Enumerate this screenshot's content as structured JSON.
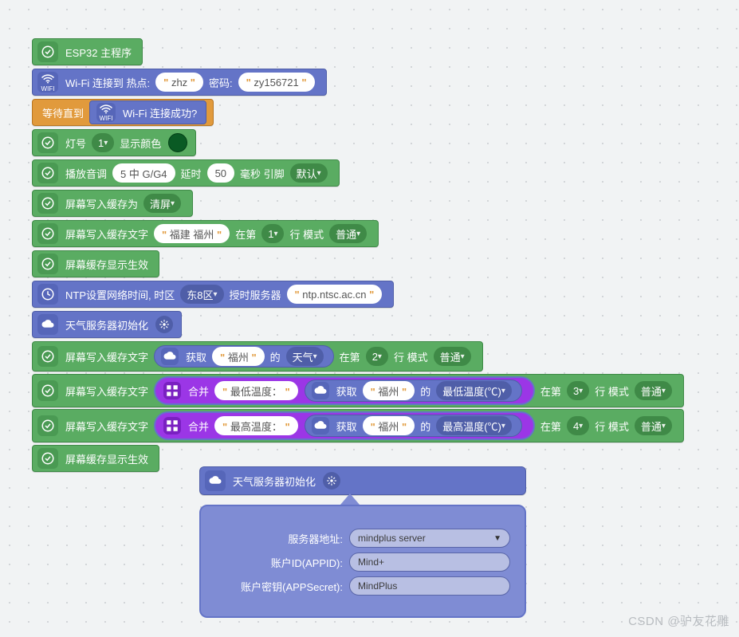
{
  "blocks": {
    "b0": {
      "label": "ESP32 主程序"
    },
    "b1": {
      "prefix": "Wi-Fi 连接到 热点:",
      "ssid": "zhz",
      "mid": "密码:",
      "pwd": "zy156721"
    },
    "b2": {
      "wait": "等待直到",
      "inner": "Wi-Fi 连接成功?"
    },
    "b3": {
      "t1": "灯号",
      "led": "1",
      "t2": "显示颜色"
    },
    "b4": {
      "t1": "播放音调",
      "note": "5 中 G/G4",
      "t2": "延时",
      "ms": "50",
      "t3": "毫秒 引脚",
      "pin": "默认"
    },
    "b5": {
      "t1": "屏幕写入缓存为",
      "opt": "清屏"
    },
    "b6": {
      "t1": "屏幕写入缓存文字",
      "txt": "福建 福州",
      "t2": "在第",
      "line": "1",
      "t3": "行 模式",
      "mode": "普通"
    },
    "b7": {
      "t1": "屏幕缓存显示生效"
    },
    "b8": {
      "t1": "NTP设置网络时间, 时区",
      "tz": "东8区",
      "t2": "授时服务器",
      "srv": "ntp.ntsc.ac.cn"
    },
    "b9": {
      "t1": "天气服务器初始化"
    },
    "b10": {
      "t1": "屏幕写入缓存文字",
      "get": "获取",
      "city": "福州",
      "of": "的",
      "field": "天气",
      "t2": "在第",
      "line": "2",
      "t3": "行 模式",
      "mode": "普通"
    },
    "b11": {
      "t1": "屏幕写入缓存文字",
      "join": "合并",
      "label": "最低温度：",
      "get": "获取",
      "city": "福州",
      "of": "的",
      "field": "最低温度(℃)",
      "t2": "在第",
      "line": "3",
      "t3": "行 模式",
      "mode": "普通"
    },
    "b12": {
      "t1": "屏幕写入缓存文字",
      "join": "合并",
      "label": "最高温度：",
      "get": "获取",
      "city": "福州",
      "of": "的",
      "field": "最高温度(℃)",
      "t2": "在第",
      "line": "4",
      "t3": "行 模式",
      "mode": "普通"
    },
    "b13": {
      "t1": "屏幕缓存显示生效"
    }
  },
  "popover": {
    "title": "天气服务器初始化",
    "rows": {
      "server_label": "服务器地址:",
      "server_value": "mindplus server",
      "appid_label": "账户ID(APPID):",
      "appid_value": "Mind+",
      "secret_label": "账户密钥(APPSecret):",
      "secret_value": "MindPlus"
    }
  },
  "watermark": "CSDN @驴友花雕"
}
